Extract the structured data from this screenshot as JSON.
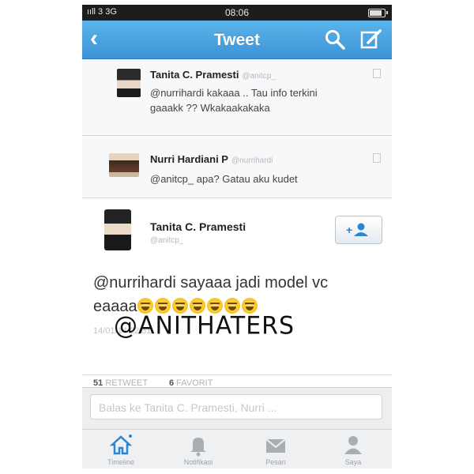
{
  "status_bar": {
    "signal": "ııll 3  3G",
    "time": "08:06"
  },
  "nav": {
    "title": "Tweet",
    "back_icon": "chevron-left-icon",
    "search_icon": "search-icon",
    "compose_icon": "compose-icon"
  },
  "replies": [
    {
      "name": "Tanita C. Pramesti",
      "handle": "@anitcp_",
      "text_line1": "@nurrihardi kakaaa .. Tau info terkini",
      "text_line2": "gaaakk ?? Wkakaakakaka"
    },
    {
      "name": "Nurri Hardiani P",
      "handle": "@nurrihardi",
      "text_line1": "@anitcp_ apa? Gatau aku kudet"
    }
  ],
  "main_tweet": {
    "name": "Tanita C. Pramesti",
    "handle": "@anitcp_",
    "text_line1": "@nurrihardi sayaaa jadi model vc",
    "text_line2": "eaaaa",
    "timestamp": "14/01/14 22:31"
  },
  "watermark": "@ANITHATERS",
  "stats": {
    "retweets": "51",
    "retweet_label": "RETWEET",
    "favorites": "6",
    "favorite_label": "FAVORIT"
  },
  "reply_box": {
    "placeholder": "Balas ke Tanita C. Pramesti, Nurri ..."
  },
  "tabs": [
    {
      "label": "Timeline",
      "icon": "home-icon"
    },
    {
      "label": "Notifikasi",
      "icon": "bell-icon"
    },
    {
      "label": "Pesan",
      "icon": "envelope-icon"
    },
    {
      "label": "Saya",
      "icon": "person-icon"
    }
  ],
  "colors": {
    "nav_bar": "#3c94d6",
    "accent": "#2a86d0"
  }
}
